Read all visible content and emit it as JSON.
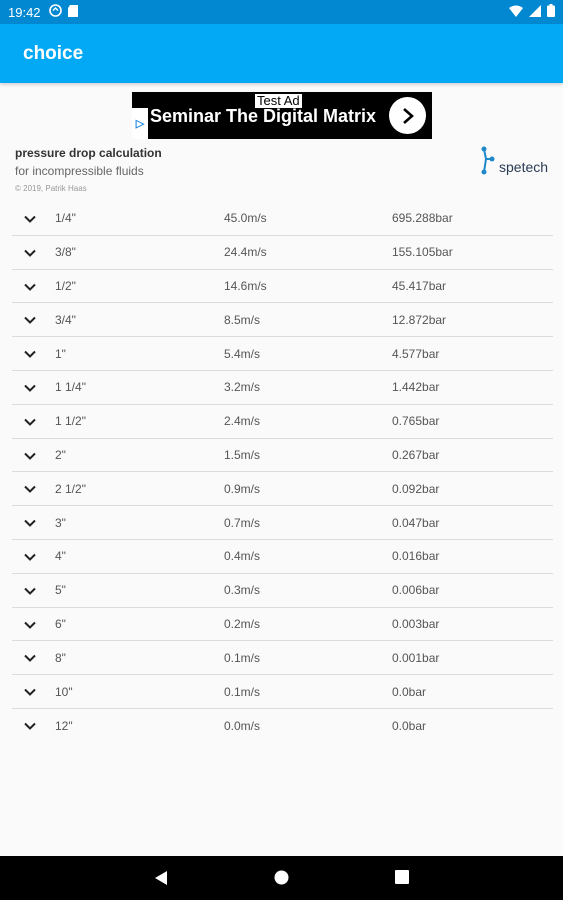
{
  "status_bar": {
    "time": "19:42"
  },
  "app_bar": {
    "title": "choice"
  },
  "ad": {
    "test_label": "Test Ad",
    "headline": "Seminar The Digital Matrix"
  },
  "header": {
    "title": "pressure drop calculation",
    "subtitle": "for incompressible fluids",
    "copyright": "© 2019, Patrik Haas"
  },
  "logo": {
    "text": "spetech",
    "color": "#1e88c8"
  },
  "rows": [
    {
      "size": "1/4\"",
      "velocity": "45.0m/s",
      "pressure": "695.288bar"
    },
    {
      "size": "3/8\"",
      "velocity": "24.4m/s",
      "pressure": "155.105bar"
    },
    {
      "size": "1/2\"",
      "velocity": "14.6m/s",
      "pressure": "45.417bar"
    },
    {
      "size": "3/4\"",
      "velocity": "8.5m/s",
      "pressure": "12.872bar"
    },
    {
      "size": "1\"",
      "velocity": "5.4m/s",
      "pressure": "4.577bar"
    },
    {
      "size": "1 1/4\"",
      "velocity": "3.2m/s",
      "pressure": "1.442bar"
    },
    {
      "size": "1 1/2\"",
      "velocity": "2.4m/s",
      "pressure": "0.765bar"
    },
    {
      "size": "2\"",
      "velocity": "1.5m/s",
      "pressure": "0.267bar"
    },
    {
      "size": "2 1/2\"",
      "velocity": "0.9m/s",
      "pressure": "0.092bar"
    },
    {
      "size": "3\"",
      "velocity": "0.7m/s",
      "pressure": "0.047bar"
    },
    {
      "size": "4\"",
      "velocity": "0.4m/s",
      "pressure": "0.016bar"
    },
    {
      "size": "5\"",
      "velocity": "0.3m/s",
      "pressure": "0.006bar"
    },
    {
      "size": "6\"",
      "velocity": "0.2m/s",
      "pressure": "0.003bar"
    },
    {
      "size": "8\"",
      "velocity": "0.1m/s",
      "pressure": "0.001bar"
    },
    {
      "size": "10\"",
      "velocity": "0.1m/s",
      "pressure": "0.0bar"
    },
    {
      "size": "12\"",
      "velocity": "0.0m/s",
      "pressure": "0.0bar"
    }
  ],
  "colors": {
    "status_bar": "#0288d1",
    "app_bar": "#03a9f4",
    "background": "#fafafa",
    "nav_bar": "#000000"
  }
}
